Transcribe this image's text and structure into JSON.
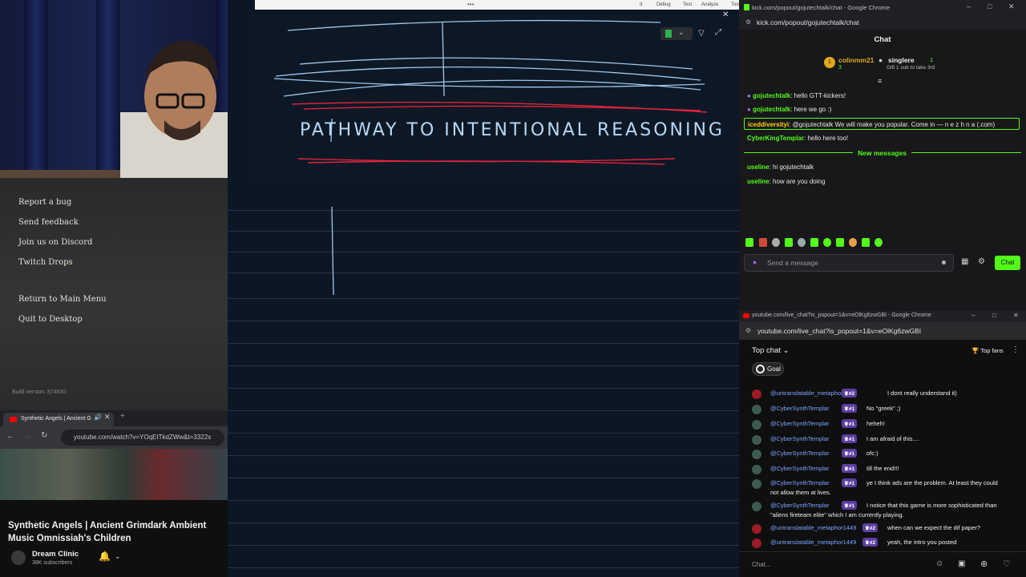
{
  "game_menu": {
    "items": [
      "Report a bug",
      "Send feedback",
      "Join us on Discord",
      "Twitch Drops",
      "Return to Main Menu",
      "Quit to Desktop"
    ],
    "build_version": "Build version: 874630"
  },
  "yt_mini": {
    "tab_title": "Synthetic Angels | Ancient G",
    "url": "youtube.com/watch?v=YOqEITkdZWw&t=3322s",
    "video_title": "Synthetic Angels | Ancient Grimdark Ambient Music Omnissiah's Children",
    "channel": "Dream Clinic",
    "subscribers": "38K subscribers"
  },
  "board": {
    "menu_items": [
      "d",
      "Debug",
      "Test",
      "Analyze",
      "Too"
    ],
    "title": "PATHWAY TO INTENTIONAL REASONING"
  },
  "kick": {
    "window_title": "kick.com/popout/gojutechtalk/chat - Google Chrome",
    "url": "kick.com/popout/gojutechtalk/chat",
    "chat_header": "Chat",
    "leaderboard": {
      "rank": "1",
      "top_user": "colinmm21",
      "top_count": "3",
      "second_user": "singlere",
      "second_count": "1",
      "gift_text": "Gift 1 sub to take 3rd"
    },
    "messages": [
      {
        "user": "gojutechtalk",
        "text": "hello GTT-kickers!"
      },
      {
        "user": "gojutechtalk",
        "text": "here we go :)"
      },
      {
        "user": "iceddiversityi",
        "text": "@gojutechtalk We will make you popular. Come in — n e z h n a (.com)"
      },
      {
        "user": "CyberKingTemplar",
        "text": "hello here too!"
      }
    ],
    "new_messages_label": "New messages",
    "new_messages": [
      {
        "user": "useline",
        "text": "hi gojutechtalk"
      },
      {
        "user": "useline",
        "text": "how are you doing"
      }
    ],
    "input_placeholder": "Send a message",
    "chat_button": "Chat",
    "colors": {
      "accent": "#53fc18",
      "gojutechtalk": "#53fc18",
      "iceddiversityi": "#ffd000",
      "CyberKingTemplar": "#53fc18",
      "useline": "#53fc18"
    }
  },
  "ytchat": {
    "window_title": "youtube.com/live_chat?is_popout=1&v=eOlKg6zwGBI - Google Chrome",
    "url": "youtube.com/live_chat?is_popout=1&v=eOlKg6zwGBI",
    "top_chat": "Top chat",
    "top_fans": "Top fans",
    "goal": "Goal",
    "messages": [
      {
        "user": "@untranslatable_metaphor1449",
        "badge": "#2",
        "text": "I dont really understand it)",
        "avatar": "red"
      },
      {
        "user": "@CyberSynthTemplar",
        "badge": "#1",
        "text": "No \"greek\" ;)",
        "avatar": "green"
      },
      {
        "user": "@CyberSynthTemplar",
        "badge": "#1",
        "text": "heheh!",
        "avatar": "green"
      },
      {
        "user": "@CyberSynthTemplar",
        "badge": "#1",
        "text": "I am afraid of this....",
        "avatar": "green"
      },
      {
        "user": "@CyberSynthTemplar",
        "badge": "#1",
        "text": "ofc:)",
        "avatar": "green"
      },
      {
        "user": "@CyberSynthTemplar",
        "badge": "#1",
        "text": "till the end!!!",
        "avatar": "green"
      },
      {
        "user": "@CyberSynthTemplar",
        "badge": "#1",
        "text": "ye I think ads are the problem. At least they could",
        "text2": "not allow them at lives.",
        "avatar": "green"
      },
      {
        "user": "@CyberSynthTemplar",
        "badge": "#1",
        "text": "I notice that this game is more sophisticated than",
        "text2": "\"aliens fireteam elite\" which I am currently playing.",
        "avatar": "green"
      },
      {
        "user": "@untranslatable_metaphor1449",
        "badge": "#2",
        "text": "when can we expect the dif paper?",
        "avatar": "red"
      },
      {
        "user": "@untranslatable_metaphor1449",
        "badge": "#2",
        "text": "yeah, the intro you posted",
        "avatar": "red"
      }
    ],
    "input_placeholder": "Chat..."
  }
}
